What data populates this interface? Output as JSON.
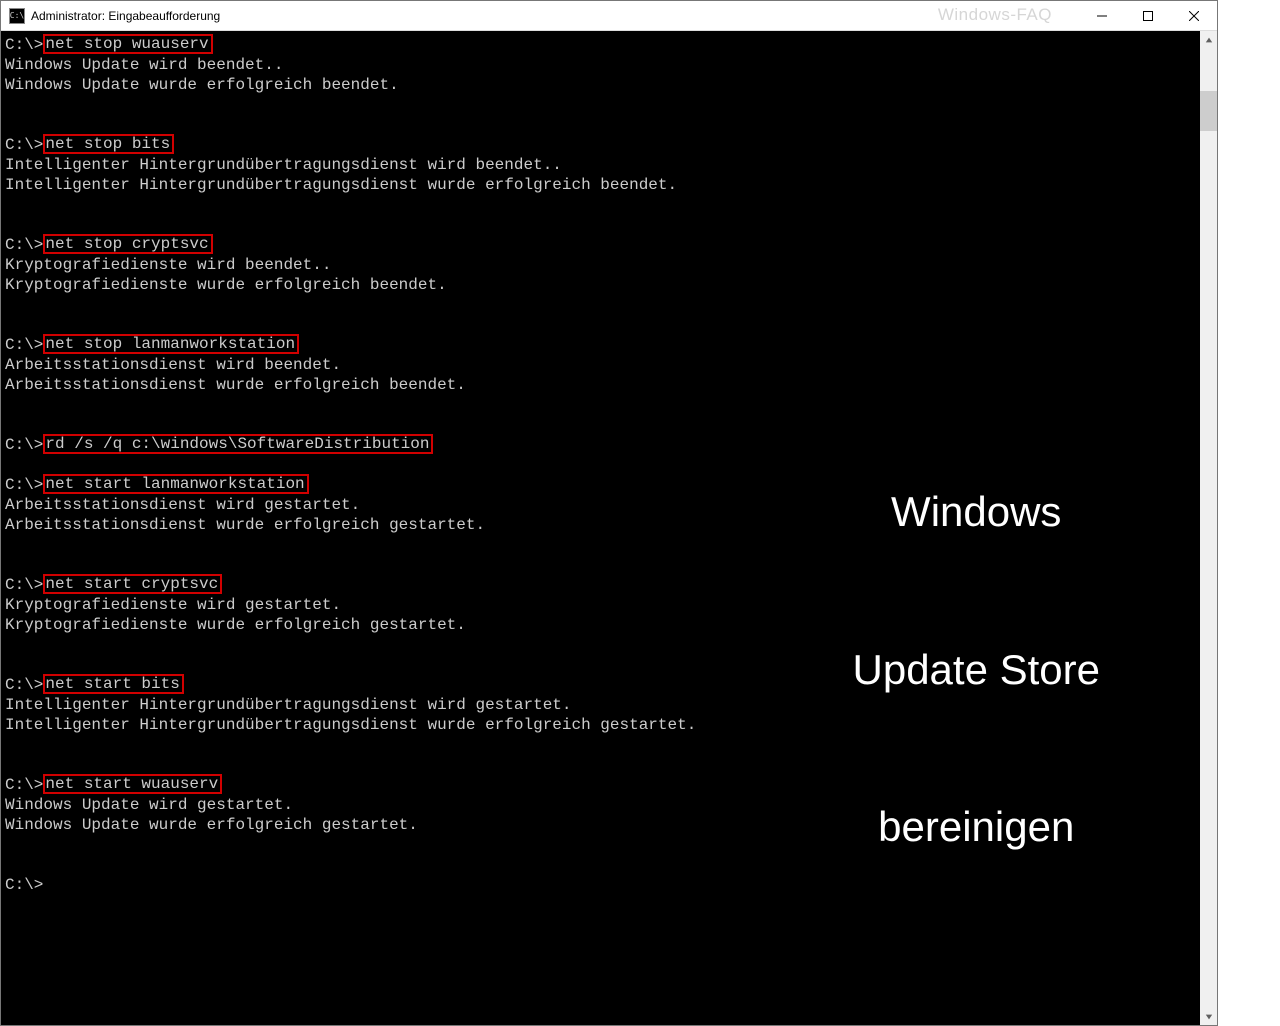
{
  "titlebar": {
    "icon_glyph": "C:\\",
    "title": "Administrator: Eingabeaufforderung"
  },
  "watermark": "Windows-FAQ",
  "overlay": {
    "line1": "Windows",
    "line2": "Update Store",
    "line3": "bereinigen"
  },
  "prompt": "C:\\>",
  "blocks": [
    {
      "cmd": "net stop wuauserv",
      "out": [
        "Windows Update wird beendet..",
        "Windows Update wurde erfolgreich beendet."
      ],
      "trailing_blank": 2
    },
    {
      "cmd": "net stop bits",
      "out": [
        "Intelligenter Hintergrundübertragungsdienst wird beendet..",
        "Intelligenter Hintergrundübertragungsdienst wurde erfolgreich beendet."
      ],
      "trailing_blank": 2
    },
    {
      "cmd": "net stop cryptsvc",
      "out": [
        "Kryptografiedienste wird beendet..",
        "Kryptografiedienste wurde erfolgreich beendet."
      ],
      "trailing_blank": 2
    },
    {
      "cmd": "net stop lanmanworkstation",
      "out": [
        "Arbeitsstationsdienst wird beendet.",
        "Arbeitsstationsdienst wurde erfolgreich beendet."
      ],
      "trailing_blank": 2
    },
    {
      "cmd": "rd /s /q c:\\windows\\SoftwareDistribution",
      "out": [],
      "trailing_blank": 1
    },
    {
      "cmd": "net start lanmanworkstation",
      "out": [
        "Arbeitsstationsdienst wird gestartet.",
        "Arbeitsstationsdienst wurde erfolgreich gestartet."
      ],
      "trailing_blank": 2
    },
    {
      "cmd": "net start cryptsvc",
      "out": [
        "Kryptografiedienste wird gestartet.",
        "Kryptografiedienste wurde erfolgreich gestartet."
      ],
      "trailing_blank": 2
    },
    {
      "cmd": "net start bits",
      "out": [
        "Intelligenter Hintergrundübertragungsdienst wird gestartet.",
        "Intelligenter Hintergrundübertragungsdienst wurde erfolgreich gestartet."
      ],
      "trailing_blank": 2
    },
    {
      "cmd": "net start wuauserv",
      "out": [
        "Windows Update wird gestartet.",
        "Windows Update wurde erfolgreich gestartet."
      ],
      "trailing_blank": 2
    }
  ],
  "final_prompt": "C:\\>"
}
